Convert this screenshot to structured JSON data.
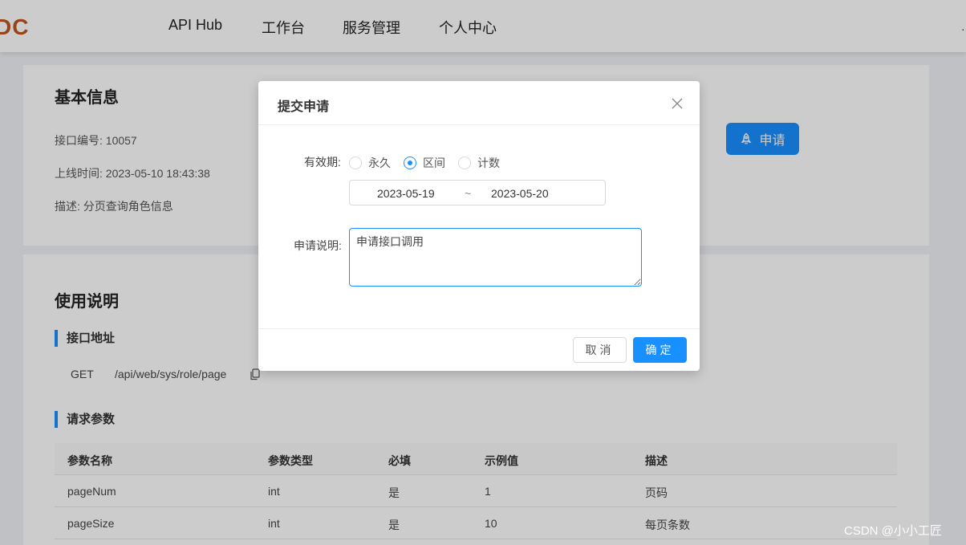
{
  "header": {
    "logo": "DC",
    "nav": [
      "API Hub",
      "工作台",
      "服务管理",
      "个人中心"
    ]
  },
  "basic_info": {
    "title": "基本信息",
    "interface_id": "接口编号: 10057",
    "online_time": "上线时间: 2023-05-10 18:43:38",
    "description": "描述: 分页查询角色信息",
    "apply_button": "申请"
  },
  "usage": {
    "title": "使用说明",
    "address_title": "接口地址",
    "method": "GET",
    "path": "/api/web/sys/role/page",
    "params_title": "请求参数",
    "columns": [
      "参数名称",
      "参数类型",
      "必填",
      "示例值",
      "描述"
    ],
    "rows": [
      [
        "pageNum",
        "int",
        "是",
        "1",
        "页码"
      ],
      [
        "pageSize",
        "int",
        "是",
        "10",
        "每页条数"
      ]
    ]
  },
  "modal": {
    "title": "提交申请",
    "validity_label": "有效期:",
    "options": [
      "永久",
      "区间",
      "计数"
    ],
    "selected_option": "区间",
    "range_start": "2023-05-19",
    "range_sep": "~",
    "range_end": "2023-05-20",
    "desc_label": "申请说明:",
    "desc_value": "申请接口调用",
    "cancel": "取消",
    "ok": "确定"
  },
  "watermark": "CSDN @小小工匠",
  "colors": {
    "primary": "#1890ff",
    "logo": "#c0561f"
  }
}
